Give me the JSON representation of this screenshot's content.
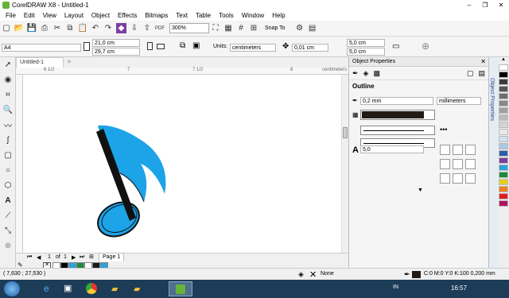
{
  "window": {
    "title": "CorelDRAW X8 - Untitled-1"
  },
  "menu": [
    "File",
    "Edit",
    "View",
    "Layout",
    "Object",
    "Effects",
    "Bitmaps",
    "Text",
    "Table",
    "Tools",
    "Window",
    "Help"
  ],
  "toolbar": {
    "zoom_value": "300%",
    "snap_label": "Snap To"
  },
  "propbar": {
    "page_size": "A4",
    "width": "21,0 cm",
    "height": "29,7 cm",
    "units_label": "Units:",
    "units_value": "centimeters",
    "nudge": "0,01 cm",
    "dup_x": "5,0 cm",
    "dup_y": "5,0 cm"
  },
  "document": {
    "tab_label": "Untitled-1",
    "ruler_unit": "centimeters",
    "ruler_h_ticks": [
      "6 1/2",
      "7",
      "7 1/2",
      "8"
    ]
  },
  "page_nav": {
    "current": "1",
    "of_label": "of",
    "total": "1",
    "page_tab": "Page 1"
  },
  "status": {
    "coords": "( 7,630 ; 27,530 )",
    "fill_label": "None",
    "outline_label": "C:0 M:0 Y:0 K:100  0,200 mm"
  },
  "panel": {
    "title": "Object Properties",
    "section": "Outline",
    "width_value": "0,2 mm",
    "width_units": "millimeters",
    "miter_value": "5,0",
    "side_tab": "Object Properties"
  },
  "taskbar": {
    "lang": "IN",
    "time": "16:57"
  },
  "colors": {
    "note_fill": "#1ca3e8",
    "note_stroke": "#111111",
    "outline_color": "#231a14",
    "palette": [
      "#ffffff",
      "#000000",
      "#3a3a3a",
      "#555555",
      "#6e6e6e",
      "#888888",
      "#a0a0a0",
      "#bbbbbb",
      "#d4d4d4",
      "#e8e8e8",
      "#cfe0f0",
      "#a8c8e8",
      "#2b5ea8",
      "#7a3fa0",
      "#29a3dc",
      "#1c8c3c",
      "#e0d020",
      "#f08020",
      "#e02020",
      "#b01060"
    ],
    "docpalette": [
      "#ffffff",
      "#000000",
      "#29a3dc",
      "#1c8c3c",
      "#ffffff",
      "#1a1a1a",
      "#29a3dc"
    ]
  }
}
